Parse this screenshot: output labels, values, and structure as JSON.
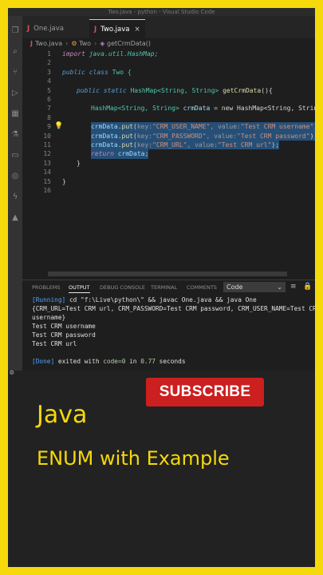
{
  "window": {
    "title": "Two.java - python - Visual Studio Code"
  },
  "tabs": [
    {
      "label": "One.java",
      "active": false
    },
    {
      "label": "Two.java",
      "active": true
    }
  ],
  "breadcrumb": {
    "file": "Two.java",
    "class": "Two",
    "method": "getCrmData()"
  },
  "editor": {
    "line_numbers": [
      "1",
      "2",
      "3",
      "4",
      "5",
      "6",
      "7",
      "8",
      "9",
      "10",
      "11",
      "12",
      "13",
      "14",
      "15",
      "16"
    ],
    "line1": {
      "kw": "import",
      "rest": "java.util.HashMap;"
    },
    "line3": {
      "kw1": "public",
      "kw2": "class",
      "name": "Two {"
    },
    "line5": {
      "kw1": "public",
      "kw2": "static",
      "type": "HashMap<String, String>",
      "fn": "getCrmData",
      "rest": "(){"
    },
    "line7": {
      "type": "HashMap<String, String>",
      "var": "crmData",
      "rest": "= new HashMap<String, String>()"
    },
    "line9": {
      "var": "crmData",
      "fn": ".put(",
      "hint1": "key:",
      "s1": "\"CRM_USER_NAME\"",
      "hint2": ", value:",
      "s2": "\"Test CRM username\"",
      "end": ");"
    },
    "line10": {
      "var": "crmData",
      "fn": ".put(",
      "hint1": "key:",
      "s1": "\"CRM_PASSWORD\"",
      "hint2": ", value:",
      "s2": "\"Test CRM password\"",
      "end": ");"
    },
    "line11": {
      "var": "crmData",
      "fn": ".put(",
      "hint1": "key:",
      "s1": "\"CRM_URL\"",
      "hint2": ", value:",
      "s2": "\"Test CRM url\"",
      "end": ");"
    },
    "line12": {
      "kw": "return",
      "var": "crmData;"
    },
    "line13": "}",
    "line15": "}"
  },
  "panel": {
    "tabs": [
      "PROBLEMS",
      "OUTPUT",
      "DEBUG CONSOLE",
      "TERMINAL",
      "COMMENTS"
    ],
    "active_tab": "OUTPUT",
    "channel": "Code",
    "lines": {
      "running_tag": "[Running]",
      "running_cmd": "cd \"f:\\Live\\python\\\" && javac One.java && java One",
      "map1": "{CRM_URL=Test CRM url, CRM_PASSWORD=Test CRM password, CRM_USER_NAME=Test CRM",
      "map2": "username}",
      "o1": "Test CRM username",
      "o2": "Test CRM password",
      "o3": "Test CRM url",
      "done_tag": "[Done]",
      "done_a": "exited with",
      "done_code": "code=0",
      "done_b": "in",
      "done_time": "0.77",
      "done_c": "seconds"
    }
  },
  "overlay": {
    "subscribe": "SUBSCRIBE",
    "title": "Java",
    "subtitle": "ENUM with Example"
  },
  "colors": {
    "frame": "#f5d90a",
    "subscribe_bg": "#cc1f1f",
    "selection": "#264f78"
  }
}
